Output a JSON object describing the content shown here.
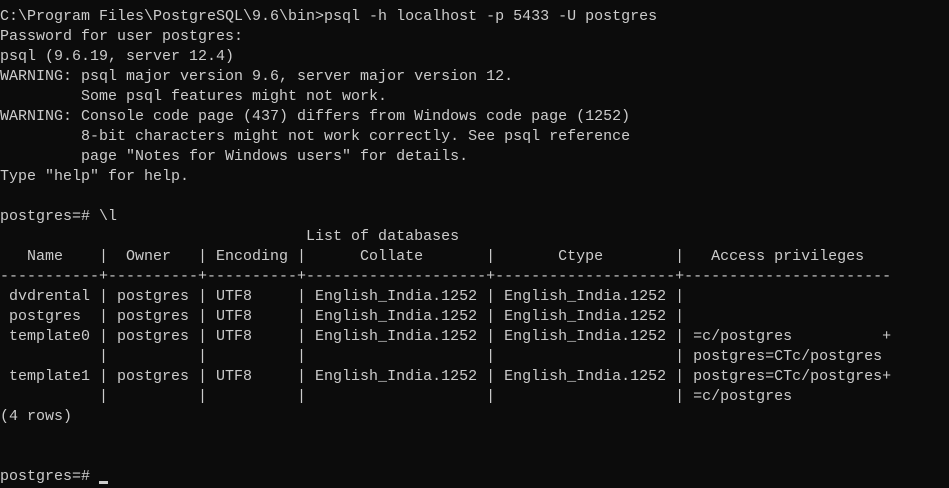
{
  "terminal": {
    "lines": [
      "C:\\Program Files\\PostgreSQL\\9.6\\bin>psql -h localhost -p 5433 -U postgres",
      "Password for user postgres:",
      "psql (9.6.19, server 12.4)",
      "WARNING: psql major version 9.6, server major version 12.",
      "         Some psql features might not work.",
      "WARNING: Console code page (437) differs from Windows code page (1252)",
      "         8-bit characters might not work correctly. See psql reference",
      "         page \"Notes for Windows users\" for details.",
      "Type \"help\" for help.",
      "",
      "postgres=# \\l",
      "                                  List of databases",
      "   Name    |  Owner   | Encoding |      Collate       |       Ctype        |   Access privileges",
      "-----------+----------+----------+--------------------+--------------------+-----------------------",
      " dvdrental | postgres | UTF8     | English_India.1252 | English_India.1252 |",
      " postgres  | postgres | UTF8     | English_India.1252 | English_India.1252 |",
      " template0 | postgres | UTF8     | English_India.1252 | English_India.1252 | =c/postgres          +",
      "           |          |          |                    |                    | postgres=CTc/postgres",
      " template1 | postgres | UTF8     | English_India.1252 | English_India.1252 | postgres=CTc/postgres+",
      "           |          |          |                    |                    | =c/postgres",
      "(4 rows)",
      "",
      "",
      "postgres=# "
    ]
  }
}
